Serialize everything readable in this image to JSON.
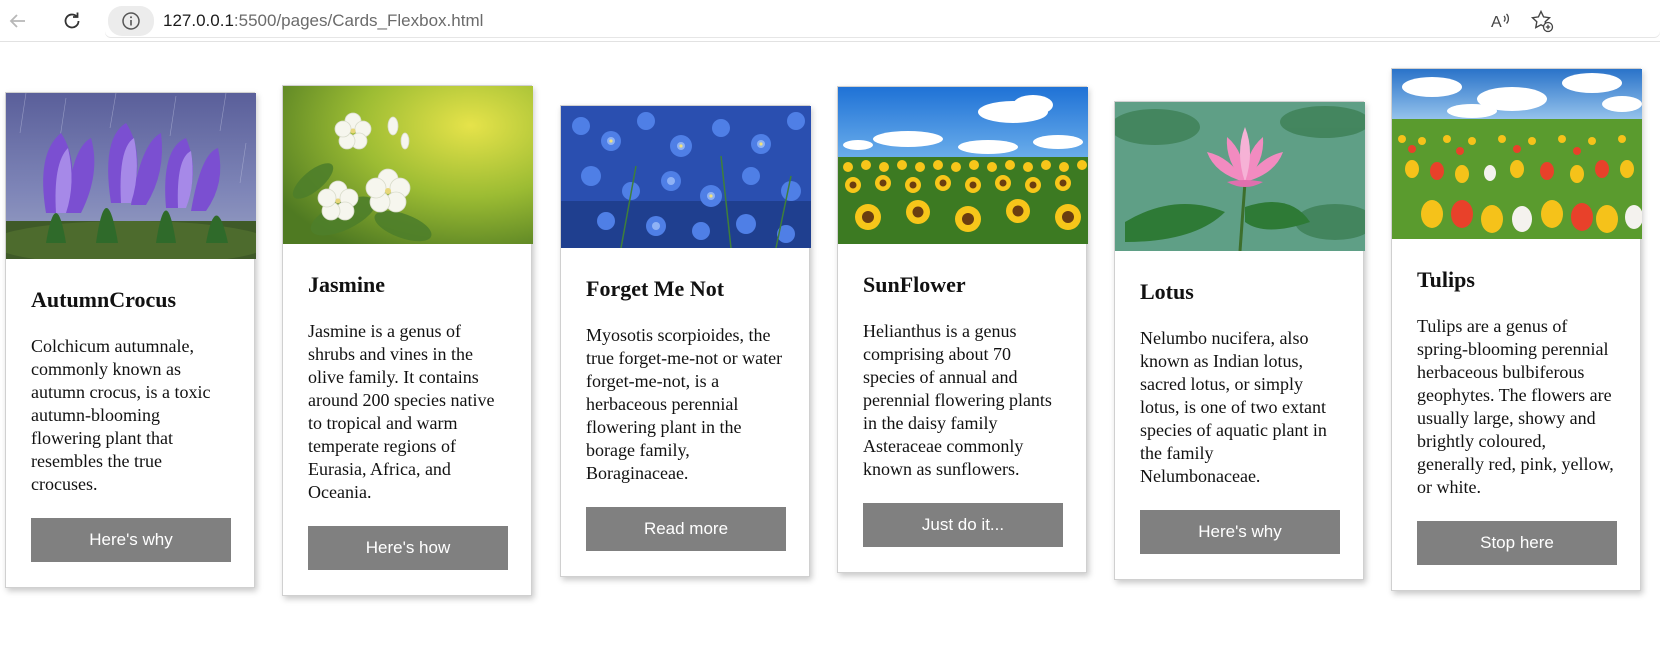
{
  "browser": {
    "url_host": "127.0.0.1",
    "url_rest": ":5500/pages/Cards_Flexbox.html",
    "icons": [
      "back-arrow-icon",
      "reload-icon",
      "info-icon",
      "read-aloud-icon",
      "add-favorite-icon"
    ]
  },
  "cards": [
    {
      "title": "AutumnCrocus",
      "text": "Colchicum autumnale, commonly known as autumn crocus, is a toxic autumn-blooming flowering plant that resembles the true crocuses.",
      "button": "Here's why",
      "image_subject": "purple crocus flowers"
    },
    {
      "title": "Jasmine",
      "text": "Jasmine is a genus of shrubs and vines in the olive family. It contains around 200 species native to tropical and warm temperate regions of Eurasia, Africa, and Oceania.",
      "button": "Here's how",
      "image_subject": "white jasmine flowers"
    },
    {
      "title": "Forget Me Not",
      "text": "Myosotis scorpioides, the true forget-me-not or water forget-me-not, is a herbaceous perennial flowering plant in the borage family, Boraginaceae.",
      "button": "Read more",
      "image_subject": "blue forget-me-not flowers"
    },
    {
      "title": "SunFlower",
      "text": "Helianthus is a genus comprising about 70 species of annual and perennial flowering plants in the daisy family Asteraceae commonly known as sunflowers.",
      "button": "Just do it...",
      "image_subject": "sunflower field under blue sky"
    },
    {
      "title": "Lotus",
      "text": "Nelumbo nucifera, also known as Indian lotus, sacred lotus, or simply lotus, is one of two extant species of aquatic plant in the family Nelumbonaceae.",
      "button": "Here's why",
      "image_subject": "pink lotus flower"
    },
    {
      "title": "Tulips",
      "text": "Tulips are a genus of spring-blooming perennial herbaceous bulbiferous geophytes. The flowers are usually large, showy and brightly coloured, generally red, pink, yellow, or white.",
      "button": "Stop here",
      "image_subject": "tulip field under blue sky"
    }
  ],
  "colors": {
    "button_bg": "#808080",
    "button_text": "#ffffff",
    "card_border": "#d0d0d0"
  }
}
